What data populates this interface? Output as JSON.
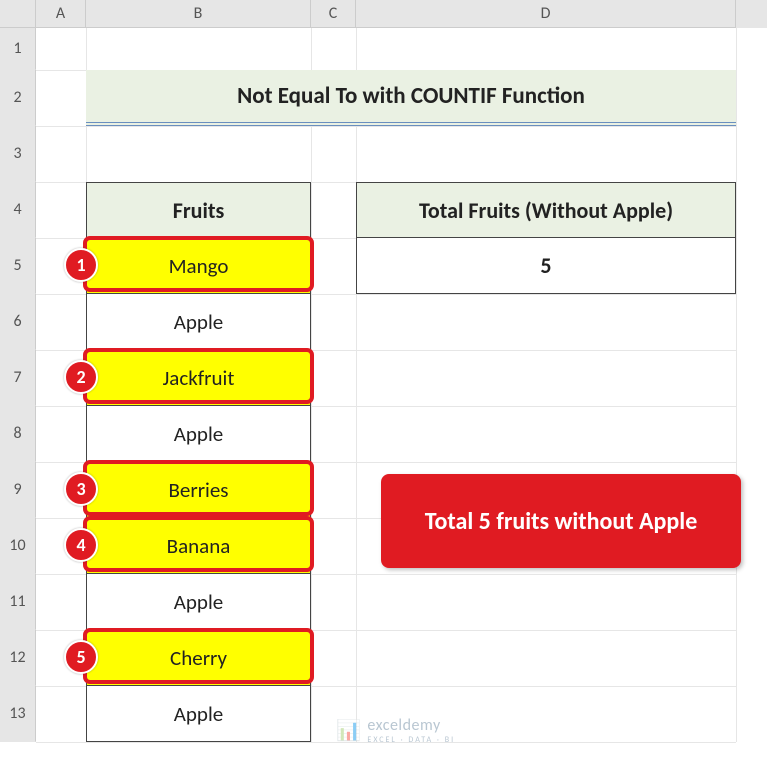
{
  "columns": [
    "A",
    "B",
    "C",
    "D"
  ],
  "rows": [
    "1",
    "2",
    "3",
    "4",
    "5",
    "6",
    "7",
    "8",
    "9",
    "10",
    "11",
    "12",
    "13"
  ],
  "title": "Not Equal To with COUNTIF Function",
  "fruits_header": "Fruits",
  "fruits": [
    "Mango",
    "Apple",
    "Jackfruit",
    "Apple",
    "Berries",
    "Banana",
    "Apple",
    "Cherry",
    "Apple"
  ],
  "highlighted_rows": [
    0,
    2,
    4,
    5,
    7
  ],
  "badges": [
    "1",
    "2",
    "3",
    "4",
    "5"
  ],
  "result_header": "Total Fruits (Without Apple)",
  "result_value": "5",
  "callout_text": "Total 5 fruits without Apple",
  "watermark_brand": "exceldemy",
  "watermark_tag": "EXCEL · DATA · BI",
  "chart_data": {
    "type": "table",
    "title": "Not Equal To with COUNTIF Function",
    "columns": [
      "Fruits"
    ],
    "rows": [
      [
        "Mango"
      ],
      [
        "Apple"
      ],
      [
        "Jackfruit"
      ],
      [
        "Apple"
      ],
      [
        "Berries"
      ],
      [
        "Banana"
      ],
      [
        "Apple"
      ],
      [
        "Cherry"
      ],
      [
        "Apple"
      ]
    ],
    "summary": {
      "Total Fruits (Without Apple)": 5
    }
  }
}
